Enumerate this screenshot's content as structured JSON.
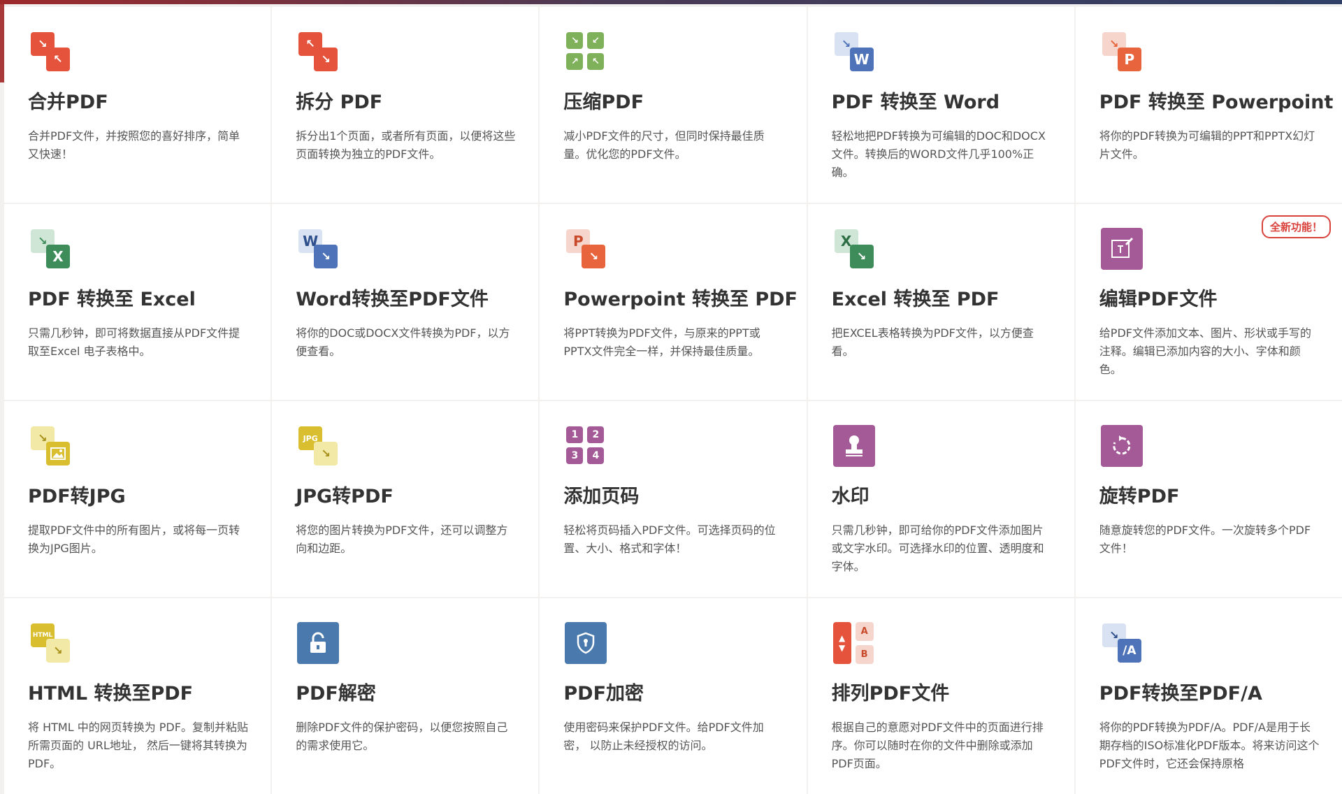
{
  "colors": {
    "red": "#e5533d",
    "green": "#7fb05a",
    "blue": "#4e73b8",
    "orange": "#e8643c",
    "excel_green": "#3d8c5a",
    "purple": "#a45a97",
    "yellow": "#d9bf2f",
    "steel": "#4a79ad"
  },
  "tools": [
    {
      "title": "合并PDF",
      "desc": "合并PDF文件，并按照您的喜好排序，简单又快速！"
    },
    {
      "title": "拆分 PDF",
      "desc": "拆分出1个页面，或者所有页面，以便将这些页面转换为独立的PDF文件。"
    },
    {
      "title": "压缩PDF",
      "desc": "减小PDF文件的尺寸，但同时保持最佳质量。优化您的PDF文件。"
    },
    {
      "title": "PDF 转换至 Word",
      "desc": "轻松地把PDF转换为可编辑的DOC和DOCX文件。转换后的WORD文件几乎100%正确。",
      "icon_letter": "W"
    },
    {
      "title": "PDF 转换至 Powerpoint",
      "desc": "将你的PDF转换为可编辑的PPT和PPTX幻灯片文件。",
      "icon_letter": "P"
    },
    {
      "title": "PDF 转换至 Excel",
      "desc": "只需几秒钟，即可将数据直接从PDF文件提取至Excel 电子表格中。",
      "icon_letter": "X"
    },
    {
      "title": "Word转换至PDF文件",
      "desc": "将你的DOC或DOCX文件转换为PDF，以方便查看。",
      "icon_letter": "W"
    },
    {
      "title": "Powerpoint 转换至 PDF",
      "desc": "将PPT转换为PDF文件，与原来的PPT或PPTX文件完全一样，并保持最佳质量。",
      "icon_letter": "P"
    },
    {
      "title": "Excel 转换至 PDF",
      "desc": "把EXCEL表格转换为PDF文件，以方便查看。",
      "icon_letter": "X"
    },
    {
      "title": "编辑PDF文件",
      "desc": "给PDF文件添加文本、图片、形状或手写的注释。编辑已添加内容的大小、字体和颜色。",
      "badge": "全新功能！"
    },
    {
      "title": "PDF转JPG",
      "desc": "提取PDF文件中的所有图片，或将每一页转换为JPG图片。"
    },
    {
      "title": "JPG转PDF",
      "desc": "将您的图片转换为PDF文件，还可以调整方向和边距。",
      "icon_letter": "JPG"
    },
    {
      "title": "添加页码",
      "desc": "轻松将页码插入PDF文件。可选择页码的位置、大小、格式和字体！",
      "icon_digits": [
        "1",
        "2",
        "3",
        "4"
      ]
    },
    {
      "title": "水印",
      "desc": "只需几秒钟，即可给你的PDF文件添加图片或文字水印。可选择水印的位置、透明度和字体。"
    },
    {
      "title": "旋转PDF",
      "desc": "随意旋转您的PDF文件。一次旋转多个PDF文件！"
    },
    {
      "title": "HTML 转换至PDF",
      "desc": "将 HTML 中的网页转换为 PDF。复制并粘贴所需页面的 URL地址， 然后一键将其转换为 PDF。",
      "icon_letter": "HTML"
    },
    {
      "title": "PDF解密",
      "desc": "删除PDF文件的保护密码，以便您按照自己的需求使用它。"
    },
    {
      "title": "PDF加密",
      "desc": "使用密码来保护PDF文件。给PDF文件加密， 以防止未经授权的访问。"
    },
    {
      "title": "排列PDF文件",
      "desc": "根据自己的意愿对PDF文件中的页面进行排序。你可以随时在你的文件中删除或添加PDF页面。",
      "icon_letters": [
        "A",
        "B"
      ]
    },
    {
      "title": "PDF转换至PDF/A",
      "desc": "将你的PDF转换为PDF/A。PDF/A是用于长期存档的ISO标准化PDF版本。将来访问这个PDF文件时，它还会保持原格",
      "icon_letter": "/A"
    }
  ]
}
